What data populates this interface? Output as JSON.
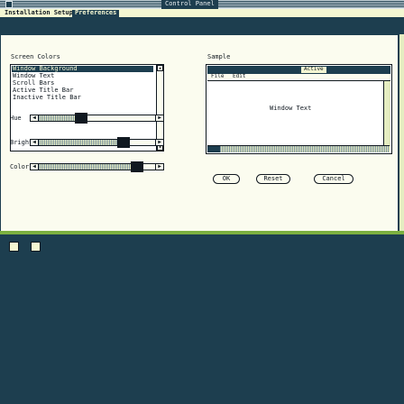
{
  "window": {
    "title": "Control Panel"
  },
  "menubar": {
    "items": [
      {
        "label": "Installation  Setup"
      },
      {
        "label": "Preferences",
        "selected": true
      }
    ]
  },
  "screen_colors": {
    "heading": "Screen Colors",
    "items": [
      {
        "label": "Window Background",
        "selected": true
      },
      {
        "label": "Window Text"
      },
      {
        "label": "Scroll Bars"
      },
      {
        "label": "Active Title Bar"
      },
      {
        "label": "Inactive Title Bar"
      }
    ]
  },
  "sliders": [
    {
      "label": "Hue",
      "value_fraction": 0.42
    },
    {
      "label": "Bright",
      "value_fraction": 0.78
    },
    {
      "label": "Color",
      "value_fraction": 0.9
    }
  ],
  "sample": {
    "heading": "Sample",
    "active_label": "Active",
    "menu": [
      "File",
      "Edit"
    ],
    "window_text": "Window Text"
  },
  "buttons": {
    "ok": "OK",
    "reset": "Reset",
    "cancel": "Cancel"
  },
  "colors": {
    "desktop": "#1d3e4f",
    "panel_bg": "#fbfcef",
    "accent_green": "#7cb040",
    "menubar_bg": "#f4f7d2"
  },
  "icons": [
    "close-box-icon",
    "scroll-up-arrow-icon",
    "scroll-down-arrow-icon",
    "slider-left-arrow-icon",
    "slider-right-arrow-icon",
    "desktop-drive-icon",
    "desktop-folder-icon"
  ]
}
